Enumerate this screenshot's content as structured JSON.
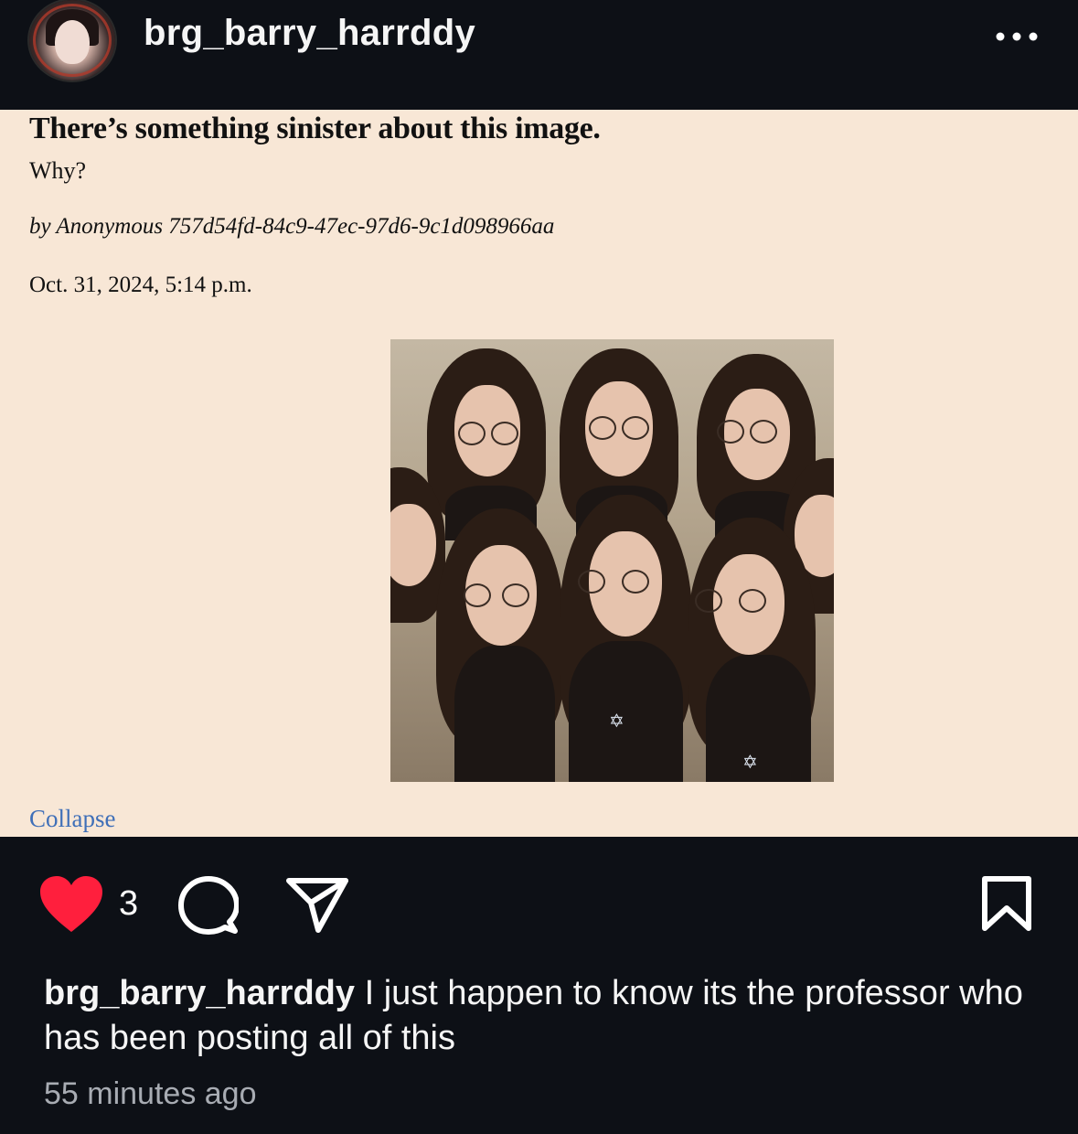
{
  "header": {
    "username": "brg_barry_harrddy",
    "avatar_icon": "profile-avatar",
    "more_icon": "ellipsis-icon"
  },
  "post_media": {
    "title": "There’s something sinister about this image.",
    "subtitle": "Why?",
    "author": "by Anonymous 757d54fd-84c9-47ec-97d6-9c1d098966aa",
    "date": "Oct. 31, 2024, 5:14 p.m.",
    "collapse_label": "Collapse",
    "image_icon": "group-portrait-photo"
  },
  "actions": {
    "like_icon": "heart-icon",
    "like_count": "3",
    "comment_icon": "comment-icon",
    "share_icon": "paper-plane-icon",
    "save_icon": "bookmark-icon",
    "like_color": "#ff1f3d"
  },
  "caption": {
    "username": "brg_barry_harrddy",
    "text": " I just happen to know its the professor who has been posting all of this"
  },
  "timestamp": "55 minutes ago"
}
